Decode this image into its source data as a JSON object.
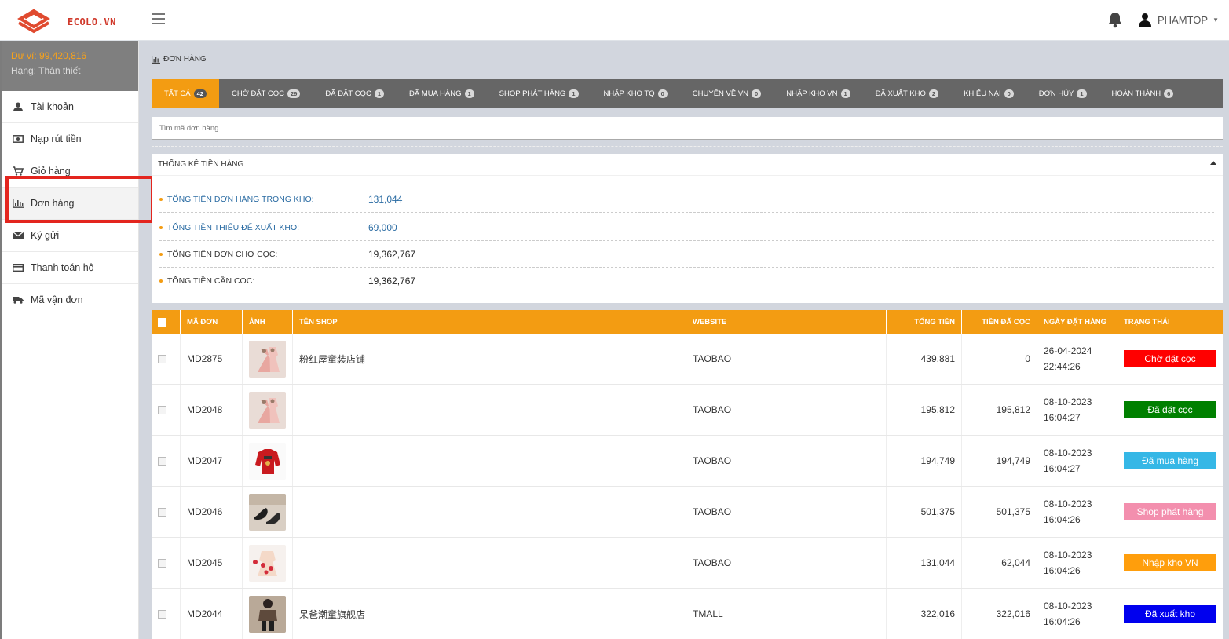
{
  "brand": {
    "name": "ECOLO.VN",
    "color": "#d0392b"
  },
  "header": {
    "username": "PHAMTOP",
    "menu_icon": "hamburger-icon",
    "notify_icon": "bell-icon"
  },
  "sidebar": {
    "balance": "Dư ví: 99,420,816",
    "rank": "Hạng: Thân thiết",
    "items": [
      {
        "label": "Tài khoản",
        "icon": "user-icon"
      },
      {
        "label": "Nạp rút tiền",
        "icon": "money-icon"
      },
      {
        "label": "Giỏ hàng",
        "icon": "cart-icon"
      },
      {
        "label": "Đơn hàng",
        "icon": "chart-icon"
      },
      {
        "label": "Ký gửi",
        "icon": "envelope-icon"
      },
      {
        "label": "Thanh toán hộ",
        "icon": "credit-card-icon"
      },
      {
        "label": "Mã vận đơn",
        "icon": "truck-icon"
      }
    ]
  },
  "breadcrumb": "ĐƠN HÀNG",
  "tabs": [
    {
      "label": "TẤT CẢ",
      "count": "42"
    },
    {
      "label": "CHỜ ĐẶT CỌC",
      "count": "29"
    },
    {
      "label": "ĐÃ ĐẶT CỌC",
      "count": "1"
    },
    {
      "label": "ĐÃ MUA HÀNG",
      "count": "1"
    },
    {
      "label": "SHOP PHÁT HÀNG",
      "count": "1"
    },
    {
      "label": "NHẬP KHO TQ",
      "count": "0"
    },
    {
      "label": "CHUYỂN VỀ VN",
      "count": "0"
    },
    {
      "label": "NHẬP KHO VN",
      "count": "1"
    },
    {
      "label": "ĐÃ XUẤT KHO",
      "count": "2"
    },
    {
      "label": "KHIẾU NẠI",
      "count": "0"
    },
    {
      "label": "ĐƠN HỦY",
      "count": "1"
    },
    {
      "label": "HOÀN THÀNH",
      "count": "6"
    }
  ],
  "search": {
    "placeholder": "Tìm mã đơn hàng"
  },
  "stats": {
    "title": "THỐNG KÊ TIỀN HÀNG",
    "rows": [
      {
        "label": "TỔNG TIỀN ĐƠN HÀNG TRONG KHO:",
        "value": "131,044"
      },
      {
        "label": "TỔNG TIỀN THIẾU ĐỂ XUẤT KHO:",
        "value": "69,000"
      },
      {
        "label": "TỔNG TIỀN ĐƠN CHỜ CỌC:",
        "value": "19,362,767"
      },
      {
        "label": "TỔNG TIỀN CẦN CỌC:",
        "value": "19,362,767"
      }
    ]
  },
  "table": {
    "headers": {
      "ma": "MÃ ĐƠN",
      "anh": "ẢNH",
      "shop": "TÊN SHOP",
      "web": "WEBSITE",
      "tong": "TỔNG TIỀN",
      "dacoc": "TIỀN ĐÃ CỌC",
      "ngay": "NGÀY ĐẶT HÀNG",
      "tt": "TRẠNG THÁI"
    },
    "rows": [
      {
        "ma": "MD2875",
        "shop": "粉红屋童装店铺",
        "web": "TAOBAO",
        "tong": "439,881",
        "dacoc": "0",
        "date": "26-04-2024",
        "time": "22:44:26",
        "status": "Chờ đặt cọc",
        "color": "#ff0000",
        "thumb": "pink-dress-thumb"
      },
      {
        "ma": "MD2048",
        "shop": "",
        "web": "TAOBAO",
        "tong": "195,812",
        "dacoc": "195,812",
        "date": "08-10-2023",
        "time": "16:04:27",
        "status": "Đã đặt cọc",
        "color": "#008000",
        "thumb": "pink-dress-thumb"
      },
      {
        "ma": "MD2047",
        "shop": "",
        "web": "TAOBAO",
        "tong": "194,749",
        "dacoc": "194,749",
        "date": "08-10-2023",
        "time": "16:04:27",
        "status": "Đã mua hàng",
        "color": "#35b7e6",
        "thumb": "red-sweater-thumb"
      },
      {
        "ma": "MD2046",
        "shop": "",
        "web": "TAOBAO",
        "tong": "501,375",
        "dacoc": "501,375",
        "date": "08-10-2023",
        "time": "16:04:26",
        "status": "Shop phát hàng",
        "color": "#f38fae",
        "thumb": "black-shoes-thumb"
      },
      {
        "ma": "MD2045",
        "shop": "",
        "web": "TAOBAO",
        "tong": "131,044",
        "dacoc": "62,044",
        "date": "08-10-2023",
        "time": "16:04:26",
        "status": "Nhập kho VN",
        "color": "#ff9e0c",
        "thumb": "floral-dress-thumb"
      },
      {
        "ma": "MD2044",
        "shop": "呆爸潮童旗舰店",
        "web": "TMALL",
        "tong": "322,016",
        "dacoc": "322,016",
        "date": "08-10-2023",
        "time": "16:04:26",
        "status": "Đã xuất kho",
        "color": "#0000ee",
        "thumb": "kid-outfit-thumb"
      }
    ]
  }
}
